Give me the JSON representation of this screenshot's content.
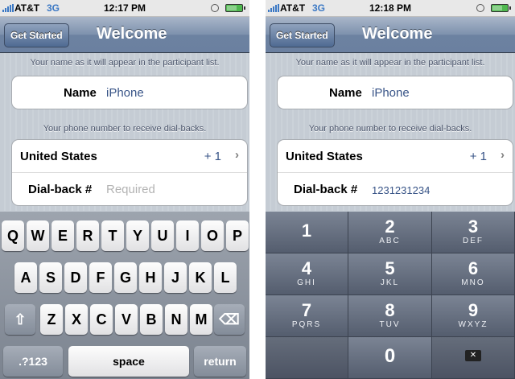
{
  "status_left": {
    "carrier": "AT&T",
    "network": "3G",
    "time": "12:17 PM"
  },
  "status_right": {
    "carrier": "AT&T",
    "network": "3G",
    "time": "12:18 PM"
  },
  "nav": {
    "button": "Get Started",
    "title": "Welcome"
  },
  "form": {
    "name_section": "Your name as it will appear in the participant list.",
    "phone_section": "Your phone number to receive dial-backs.",
    "name_label": "Name",
    "name_value": "iPhone",
    "country": "United States",
    "country_code": "+ 1",
    "dialback_label": "Dial-back #",
    "dialback_placeholder": "Required",
    "dialback_value": "1231231234"
  },
  "keyboard": {
    "row1": [
      "Q",
      "W",
      "E",
      "R",
      "T",
      "Y",
      "U",
      "I",
      "O",
      "P"
    ],
    "row2": [
      "A",
      "S",
      "D",
      "F",
      "G",
      "H",
      "J",
      "K",
      "L"
    ],
    "row3": [
      "Z",
      "X",
      "C",
      "V",
      "B",
      "N",
      "M"
    ],
    "mode_key": ".?123",
    "space_key": "space",
    "return_key": "return"
  },
  "numpad": {
    "keys": [
      {
        "digit": "1",
        "letters": ""
      },
      {
        "digit": "2",
        "letters": "ABC"
      },
      {
        "digit": "3",
        "letters": "DEF"
      },
      {
        "digit": "4",
        "letters": "GHI"
      },
      {
        "digit": "5",
        "letters": "JKL"
      },
      {
        "digit": "6",
        "letters": "MNO"
      },
      {
        "digit": "7",
        "letters": "PQRS"
      },
      {
        "digit": "8",
        "letters": "TUV"
      },
      {
        "digit": "9",
        "letters": "WXYZ"
      }
    ],
    "zero": "0"
  },
  "icons": {
    "shift": "shift-icon",
    "delete": "delete-icon",
    "chevron": "chevron-right-icon",
    "alarm": "clock-icon",
    "battery": "battery-icon",
    "signal": "signal-icon"
  }
}
